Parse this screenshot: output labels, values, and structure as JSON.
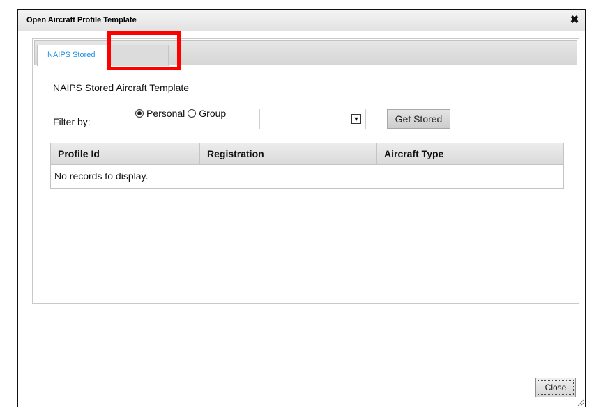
{
  "dialog": {
    "title": "Open Aircraft Profile Template",
    "close_icon": "close-x-icon"
  },
  "tabs": [
    {
      "label": "NAIPS Stored",
      "active": true
    },
    {
      "label": "",
      "active": false
    }
  ],
  "panel": {
    "section_title": "NAIPS Stored Aircraft Template",
    "filter_label": "Filter by:",
    "radio_personal": "Personal",
    "radio_group": "Group",
    "selected_radio": "Personal",
    "select_value": "",
    "get_stored_label": "Get Stored"
  },
  "grid": {
    "columns": [
      "Profile Id",
      "Registration",
      "Aircraft Type"
    ],
    "empty_message": "No records to display."
  },
  "footer": {
    "close_label": "Close"
  },
  "colors": {
    "tab_active_text": "#1e90e6",
    "highlight_border": "#ff0000"
  }
}
